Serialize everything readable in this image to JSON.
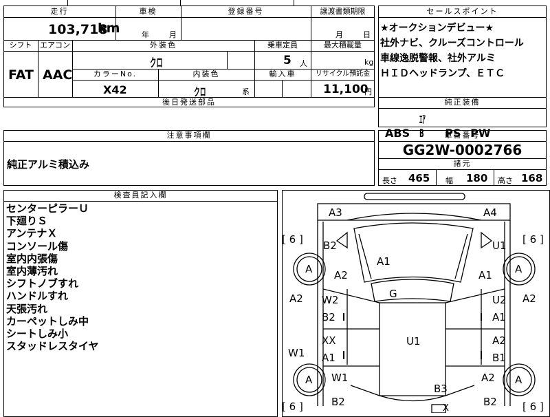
{
  "header": {
    "mileage_label": "走行",
    "mileage_value": "103,718",
    "mileage_unit": "km",
    "shaken_label": "車検",
    "shaken_year": "年",
    "shaken_month": "月",
    "reg_label": "登録番号",
    "transfer_label": "譲渡書類期限",
    "transfer_month": "月",
    "transfer_day": "日",
    "sales_label": "セールスポイント"
  },
  "row2": {
    "shift_label": "シフト",
    "shift_value": "FAT",
    "ac_label": "エアコン",
    "ac_value": "AAC",
    "ext_color_label": "外装色",
    "ext_color_value": "クロ",
    "capacity_label": "乗車定員",
    "capacity_value": "5",
    "capacity_unit": "人",
    "load_label": "最大積載量",
    "load_unit": "kg",
    "color_no_label": "カラーNo.",
    "color_no_value": "X42",
    "int_color_label": "内装色",
    "int_color_value": "クロ",
    "int_color_suffix": "系",
    "import_label": "輸入車",
    "recycle_label": "リサイクル預託金",
    "recycle_value": "11,100",
    "recycle_unit": "円"
  },
  "later_parts_label": "後日発送部品",
  "sales_points": [
    "★オークションデビュー★",
    "社外ナビ、クルーズコントロール",
    "車線逸脱警報、社外アルミ",
    "ＨＩＤヘッドランプ、ＥＴＣ"
  ],
  "equipment": {
    "label": "純正装備",
    "items": [
      "ABS",
      "ｴｱB",
      "PS",
      "PW"
    ]
  },
  "notes": {
    "label": "注意事項欄",
    "text": "純正アルミ積込み"
  },
  "chassis": {
    "label": "車台番号",
    "value": "GG2W-0002766"
  },
  "specs": {
    "label": "諸元",
    "length_label": "長さ",
    "length": "465",
    "width_label": "幅",
    "width": "180",
    "height_label": "高さ",
    "height": "168"
  },
  "inspector": {
    "label": "検査員記入欄",
    "items": [
      "センターピラーＵ",
      "下廻りＳ",
      "アンテナＸ",
      "コンソール傷",
      "室内内張傷",
      "室内薄汚れ",
      "シフトノブすれ",
      "ハンドルすれ",
      "天張汚れ",
      "カーペットしみ中",
      "シートしみ小",
      "スタッドレスタイヤ"
    ]
  },
  "diagram": {
    "tire_marks": [
      "A",
      "A",
      "A",
      "A"
    ],
    "tread_marks": [
      "6",
      "6",
      "6",
      "6"
    ],
    "panel_marks": {
      "bumper_fl": "A3",
      "bumper_fr": "A4",
      "fender_l": "B2",
      "fender_r": "U1",
      "hood": "A1",
      "hood_l": "A2",
      "hood_r": "A1",
      "roof": "G",
      "side_l": "A2",
      "side_r": "A2",
      "door_fl_top": "W2",
      "door_fl_bot": "B2",
      "door_fr_top": "U2",
      "door_fr_bot": "A1",
      "door_rl_top": "XX",
      "door_rl_bot": "A1",
      "door_rr_top": "A2",
      "door_rr_bot": "B1",
      "rocker_l": "W1",
      "quarter_l": "W1",
      "quarter_r": "A2",
      "floor": "U1",
      "trunk": "B3",
      "trunk_x": "X",
      "rear_l": "B2",
      "rear_r": "B2"
    }
  }
}
